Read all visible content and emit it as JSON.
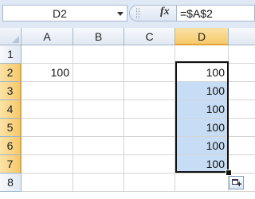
{
  "formula_bar": {
    "name_box": "D2",
    "fx_label": "fx",
    "formula": "=$A$2"
  },
  "columns": [
    "A",
    "B",
    "C",
    "D"
  ],
  "rows": [
    "1",
    "2",
    "3",
    "4",
    "5",
    "6",
    "7",
    "8"
  ],
  "cells": {
    "A2": "100",
    "D2": "100",
    "D3": "100",
    "D4": "100",
    "D5": "100",
    "D6": "100",
    "D7": "100"
  },
  "selection": {
    "active_cell": "D2",
    "range": "D2:D7"
  },
  "colors": {
    "selection_fill": "#c7ddf6",
    "selected_header": "#f6c96b"
  },
  "icons": {
    "autofill": "autofill-options-icon",
    "dropdown": "chevron-down-icon"
  }
}
